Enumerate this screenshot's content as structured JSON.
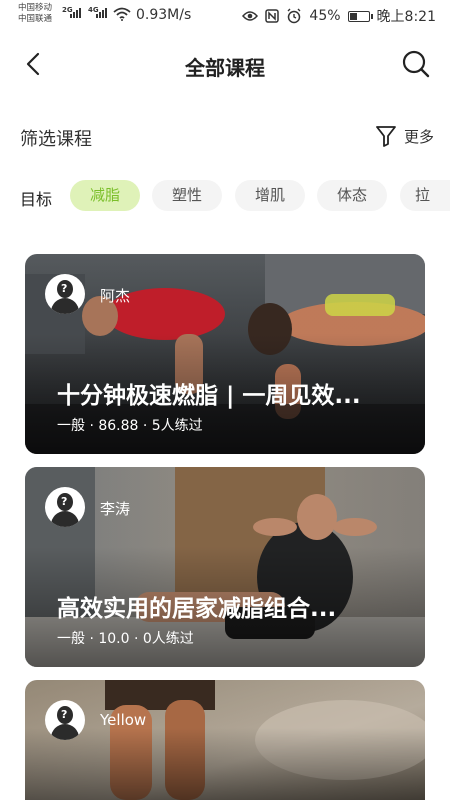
{
  "status_bar": {
    "carrier1": "中国移动",
    "carrier2": "中国联通",
    "net1": "2G",
    "net2": "4G",
    "speed": "0.93M/s",
    "battery": "45%",
    "battery_level": 0.45,
    "time": "晚上8:21"
  },
  "header": {
    "title": "全部课程"
  },
  "filter": {
    "title": "筛选课程",
    "more_label": "更多"
  },
  "tags": {
    "label": "目标",
    "items": [
      "减脂",
      "塑性",
      "增肌",
      "体态",
      "拉"
    ],
    "active_index": 0
  },
  "courses": [
    {
      "author": "阿杰",
      "title": "十分钟极速燃脂 | 一周见效...",
      "meta": "一般 · 86.88 · 5人练过"
    },
    {
      "author": "李涛",
      "title": "高效实用的居家减脂组合...",
      "meta": "一般 · 10.0 · 0人练过"
    },
    {
      "author": "Yellow",
      "title": "",
      "meta": ""
    }
  ],
  "colors": {
    "accent": "#7bbf2a",
    "chip_active_bg": "#dff2b8"
  }
}
